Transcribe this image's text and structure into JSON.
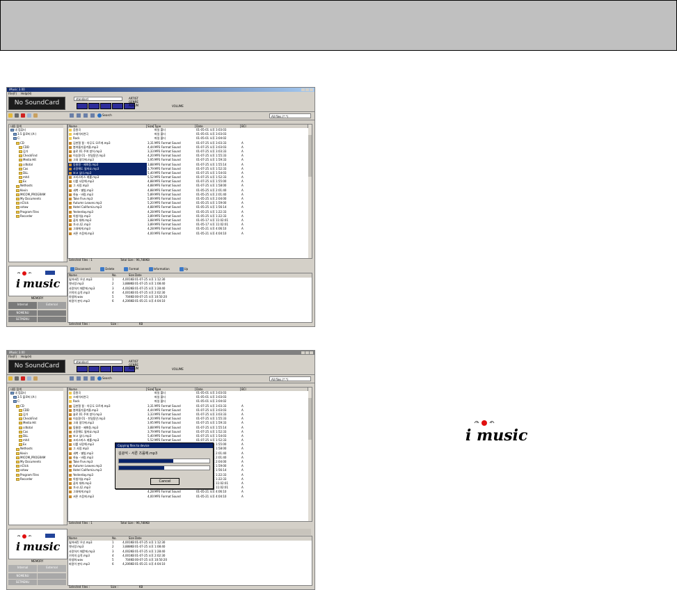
{
  "app": {
    "title": "iMusic 3.00",
    "menu": [
      "File(F)",
      "Help(H)"
    ],
    "soundcard": "No SoundCard",
    "player_combo": "standard",
    "player_labels": [
      "ARTIST",
      "GENRE",
      "ALBUM"
    ],
    "volume_label": "VOLUME",
    "search_label": "Search",
    "filter_value": "All files (*.*)",
    "tree_header": "내용 탐색",
    "tree_items": [
      "내 컴퓨터",
      "3.5 플로피 (A:)",
      "C:",
      "CD",
      "CDD",
      "김가",
      "CheckFind",
      "Media Hit",
      "cdtotal",
      "Cas",
      "DLL",
      "mh4",
      "Ex",
      "Nethosts",
      "Kevin",
      "MICOM_PROGRAM",
      "My Documents",
      "nClick",
      "sstaw",
      "Program Files",
      "Recorder"
    ],
    "file_columns": [
      "Name",
      "Size",
      "Type",
      "Date",
      "BCI"
    ],
    "files": [
      {
        "name": "음원곡",
        "size": "",
        "type": "파일 폴더",
        "date": "01-05-01 오후 3:03:03",
        "bci": ""
      },
      {
        "name": "스테이지연극",
        "size": "",
        "type": "파일 폴더",
        "date": "01-05-01 오후 3:03:03",
        "bci": ""
      },
      {
        "name": "Rock",
        "size": "",
        "type": "파일 폴더",
        "date": "01-05-01 오후 3:04:02",
        "bci": ""
      },
      {
        "name": "김현철 필 - 아무도 모르게.mp3",
        "size": "3,311KB",
        "type": "MP3 Format Sound",
        "date": "01-07-25 오후 3:03:33",
        "bci": "A"
      },
      {
        "name": "봄여름가을겨울.mp3",
        "size": "4,448KB",
        "type": "MP3 Format Sound",
        "date": "01-07-25 오후 3:03:03",
        "bci": "A"
      },
      {
        "name": "솔로 01 주여 방어.mp3",
        "size": "3,331KB",
        "type": "MP3 Format Sound",
        "date": "01-07-25 오후 3:03:33",
        "bci": "A"
      },
      {
        "name": "이승환 01 - 천일동안.mp3",
        "size": "4,205KB",
        "type": "MP3 Format Sound",
        "date": "01-07-25 오후 1:55:33",
        "bci": "A"
      },
      {
        "name": "그대 생각에.mp3",
        "size": "3,955KB",
        "type": "MP3 Format Sound",
        "date": "01-07-25 오후 1:59:33",
        "bci": "A"
      },
      {
        "name": "동물원 - 혜화동.mp3",
        "size": "3,888KB",
        "type": "MP3 Format Sound",
        "date": "01-07-25 오후 1:55:14",
        "bci": "A"
      },
      {
        "name": "사랑해도 될까요.mp3",
        "size": "3,799KB",
        "type": "MP3 Format Sound",
        "date": "01-07-25 오후 1:52:33",
        "bci": "A"
      },
      {
        "name": "보고 싶다.mp3",
        "size": "5,404KB",
        "type": "MP3 Format Sound",
        "date": "01-07-25 오후 1:54:03",
        "bci": "A"
      },
      {
        "name": "크리스마스 캐롤.mp3",
        "size": "5,524KB",
        "type": "MP3 Format Sound",
        "date": "01-07-25 오후 1:52:33",
        "bci": "A"
      },
      {
        "name": "너를 사랑해.mp3",
        "size": "4,888KB",
        "type": "MP3 Format Sound",
        "date": "01-07-25 오후 1:55:00",
        "bci": "A"
      },
      {
        "name": "그 사람.mp3",
        "size": "4,888KB",
        "type": "MP3 Format Sound",
        "date": "01-07-25 오후 1:58:00",
        "bci": "A"
      },
      {
        "name": "새벽 - 별빛.mp3",
        "size": "4,888KB",
        "type": "MP3 Format Sound",
        "date": "01-05-25 오후 2:01:40",
        "bci": "A"
      },
      {
        "name": "하늘 - 바람.mp3",
        "size": "5,894KB",
        "type": "MP3 Format Sound",
        "date": "01-05-25 오후 2:01:40",
        "bci": "A"
      },
      {
        "name": "Take Five.mp3",
        "size": "5,894KB",
        "type": "MP3 Format Sound",
        "date": "01-05-25 오후 2:04:00",
        "bci": "A"
      },
      {
        "name": "Autumn Leaves.mp3",
        "size": "5,204KB",
        "type": "MP3 Format Sound",
        "date": "01-05-25 오후 1:59:00",
        "bci": "A"
      },
      {
        "name": "Hotel California.mp3",
        "size": "4,888KB",
        "type": "MP3 Format Sound",
        "date": "01-05-25 오후 1:56:14",
        "bci": "A"
      },
      {
        "name": "Yesterday.mp3",
        "size": "4,288KB",
        "type": "MP3 Format Sound",
        "date": "01-05-25 오후 1:22:33",
        "bci": "A"
      },
      {
        "name": "아침이슬.mp3",
        "size": "3,899KB",
        "type": "MP3 Format Sound",
        "date": "01-05-25 오후 1:22:33",
        "bci": "A"
      },
      {
        "name": "꿈의 대화.mp3",
        "size": "3,888KB",
        "type": "MP3 Format Sound",
        "date": "01-05-17 오후 11:02:01",
        "bci": "A"
      },
      {
        "name": "가시나무.mp3",
        "size": "3,899KB",
        "type": "MP3 Format Sound",
        "date": "01-05-17 오후 11:02:01",
        "bci": "A"
      },
      {
        "name": "그대에게.mp3",
        "size": "4,289KB",
        "type": "MP3 Format Sound",
        "date": "01-05-21 오후 4:06:10",
        "bci": "A"
      },
      {
        "name": "서른 즈음에.mp3",
        "size": "4,004KB",
        "type": "MP3 Format Sound",
        "date": "01-05-21 오후 4:04:10",
        "bci": "A"
      }
    ],
    "status_selected": "Selected Files : 1",
    "status_total": "Total Size : 96,780KB",
    "device_tools": [
      "Disconnect",
      "Delete",
      "Format",
      "Information",
      "Up"
    ],
    "device_columns": [
      "Name",
      "No.",
      "Size",
      "Date"
    ],
    "device_files": [
      {
        "name": "잃어버린 우산.mp3",
        "no": "1",
        "size": "4,001KB",
        "date": "01-07-25 오후 1:12:30"
      },
      {
        "name": "옛사랑.mp3",
        "no": "2",
        "size": "3,888KB",
        "date": "01-07-25 오후 1:08:40"
      },
      {
        "name": "사랑하기 때문에.mp3",
        "no": "3",
        "size": "4,002KB",
        "date": "01-07-25 오후 1:28:40"
      },
      {
        "name": "기억의 습작.mp3",
        "no": "4",
        "size": "4,001KB",
        "date": "01-07-25 오후 2:02:30"
      },
      {
        "name": "야생화.wav",
        "no": "5",
        "size": "704KB",
        "date": "00-07-25 오후 10:50:20"
      },
      {
        "name": "바람이 분다.mp3",
        "no": "6",
        "size": "4,206KB",
        "date": "01-05-21 오후 4:04:10"
      }
    ],
    "memory_label": "MEMORY",
    "internal_label": "Internal",
    "external_label": "External",
    "side_buttons_1": [
      "NOMENU",
      ""
    ],
    "side_buttons_2": [
      "SETMENU",
      ""
    ],
    "device_status_selected": "Selected Files :",
    "device_status_size": "Size :",
    "device_status_kb": "KB",
    "logo_text": "music",
    "logo_brand": "i"
  },
  "dialog": {
    "title": "Copying files to device",
    "filename": "김광석 - 서른 즈음에.mp3",
    "cancel_label": "Cancel",
    "progress_current": 0.6,
    "progress_total": 0.5
  }
}
